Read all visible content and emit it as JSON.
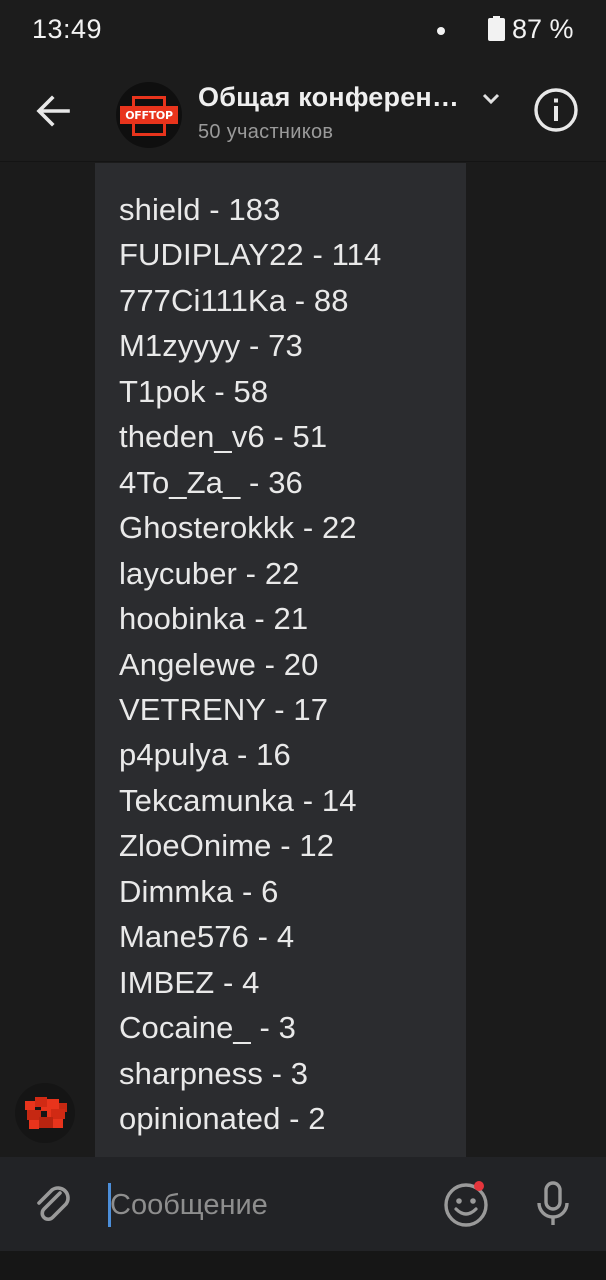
{
  "status_bar": {
    "time": "13:49",
    "battery": "87 %"
  },
  "header": {
    "avatar_text": "OFFTOP",
    "title": "Общая конференция",
    "subtitle": "50 участников",
    "icons": [
      "back-arrow-icon",
      "chevron-down-icon",
      "info-icon"
    ]
  },
  "message": {
    "lines": [
      "shield - 183",
      "FUDIPLAY22 - 114",
      "777Ci111Ka - 88",
      "M1zyyyy - 73",
      "T1pok - 58",
      "theden_v6 - 51",
      "4To_Za_ - 36",
      "Ghosterokkk - 22",
      "laycuber - 22",
      "hoobinka - 21",
      "Angelewe - 20",
      "VETRENY - 17",
      "p4pulya - 16",
      "Tekcamunka - 14",
      "ZloeOnime - 12",
      "Dimmka - 6",
      "Mane576 - 4",
      "IMBEZ - 4",
      "Cocaine_ - 3",
      "sharpness - 3",
      "opinionated - 2"
    ]
  },
  "composer": {
    "placeholder": "Сообщение",
    "icons": [
      "paperclip-icon",
      "emoji-icon",
      "microphone-icon"
    ]
  },
  "colors": {
    "background": "#1b1b1b",
    "bubble": "#2b2c2f",
    "accent": "#e8341c",
    "caret": "#4c8ed9",
    "notification": "#e5353c"
  }
}
